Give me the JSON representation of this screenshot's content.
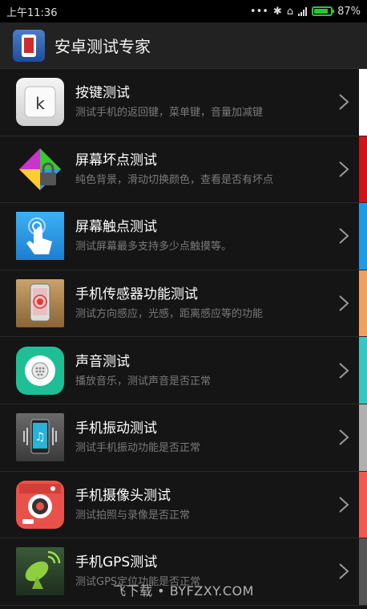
{
  "status": {
    "time": "上午11:36",
    "battery": "87%",
    "battery_level": 0.87
  },
  "header": {
    "title": "安卓测试专家"
  },
  "items": [
    {
      "title": "按键测试",
      "desc": "测试手机的返回键，菜单键，音量加减键",
      "icon": "keyboard-key-icon",
      "accent": "#ffffff"
    },
    {
      "title": "屏幕坏点测试",
      "desc": "纯色背景，滑动切换颜色，查看是否有坏点",
      "icon": "color-lock-icon",
      "accent": "#d0121b"
    },
    {
      "title": "屏幕触点测试",
      "desc": "测试屏幕最多支持多少点触摸等。",
      "icon": "touch-hand-icon",
      "accent": "#1e9be6"
    },
    {
      "title": "手机传感器功能测试",
      "desc": "测试方向感应，光感，距离感应等的功能",
      "icon": "sensor-phone-icon",
      "accent": "#f0a060"
    },
    {
      "title": "声音测试",
      "desc": "播放音乐，测试声音是否正常",
      "icon": "speaker-icon",
      "accent": "#36c8c0"
    },
    {
      "title": "手机振动测试",
      "desc": "测试手机振动功能是否正常",
      "icon": "vibrate-phone-icon",
      "accent": "#b0b0b0"
    },
    {
      "title": "手机摄像头测试",
      "desc": "测试拍照与录像是否正常",
      "icon": "camera-icon",
      "accent": "#f05a50"
    },
    {
      "title": "手机GPS测试",
      "desc": "测试GPS定位功能是否正常",
      "icon": "satellite-dish-icon",
      "accent": "#555555"
    }
  ],
  "watermark": "飞下载 • BYFZXY.COM"
}
